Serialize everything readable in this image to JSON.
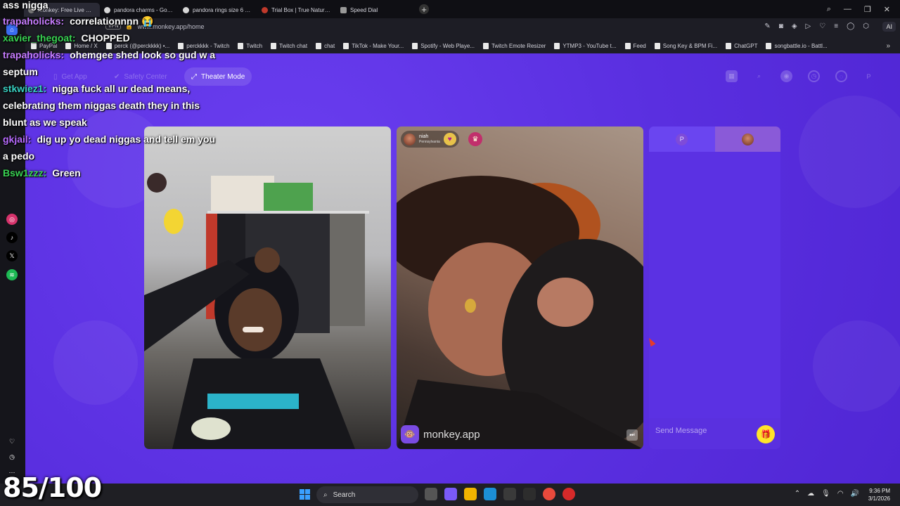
{
  "browser": {
    "tabs": [
      {
        "label": "Monkey: Free Live Video C",
        "active": true,
        "icon": "monkey-favicon"
      },
      {
        "label": "pandora charms - Google",
        "icon": "google-favicon"
      },
      {
        "label": "pandora rings size 6 - Goo",
        "icon": "google-favicon"
      },
      {
        "label": "Trial Box | True Nature Me",
        "icon": "site-favicon"
      },
      {
        "label": "Speed Dial",
        "icon": "speed-dial-icon"
      }
    ],
    "vpn_label": "VPN",
    "url": "www.monkey.app/home",
    "ai_label": "AI",
    "bookmarks": [
      "PayPal",
      "Home / X",
      "perck (@perckkkk) •...",
      "perckkkk - Twitch",
      "Twitch",
      "Twitch chat",
      "chat",
      "TikTok - Make Your...",
      "Spotify - Web Playe...",
      "Twitch Emote Resizer",
      "YTMP3 - YouTube t...",
      "Feed",
      "Song Key & BPM Fi...",
      "ChatGPT",
      "songbattle.io - Battl..."
    ]
  },
  "app": {
    "nav": {
      "get_app": "Get App",
      "safety_center": "Safety Center",
      "theater_mode": "Theater Mode",
      "profile_initial": "P"
    },
    "peer": {
      "name": "niah",
      "location": "Pennsylvania"
    },
    "watermark": "monkey.app",
    "chat_tab_initial": "P",
    "send_placeholder": "Send Message"
  },
  "stream_chat": [
    {
      "user": "",
      "text": "ass nigga",
      "color": "#ffffff"
    },
    {
      "user": "trapaholicks:",
      "text": "correlationnnn 😭",
      "color": "#c77dff"
    },
    {
      "user": "xavier_thegoat:",
      "text": "CHOPPED",
      "color": "#39d353"
    },
    {
      "user": "trapaholicks:",
      "text": "ohemgee shed look so gud w a",
      "color": "#c77dff"
    },
    {
      "user": "",
      "text": "septum",
      "color": "#ffffff"
    },
    {
      "user": "stkwiez1:",
      "text": "nigga fuck all ur dead means,",
      "color": "#39d3c4"
    },
    {
      "user": "",
      "text": "celebrating them niggas death they in this",
      "color": "#ffffff"
    },
    {
      "user": "",
      "text": "blunt as we speak",
      "color": "#ffffff"
    },
    {
      "user": "gkjail:",
      "text": "dig up yo dead niggas and tell em you",
      "color": "#b86bff"
    },
    {
      "user": "",
      "text": "a pedo",
      "color": "#ffffff"
    },
    {
      "user": "Bsw1zzz:",
      "text": "Green",
      "color": "#39d353"
    }
  ],
  "score": "85/100",
  "taskbar": {
    "search_label": "Search",
    "time": "9:36 PM",
    "date": "3/1/2026"
  }
}
